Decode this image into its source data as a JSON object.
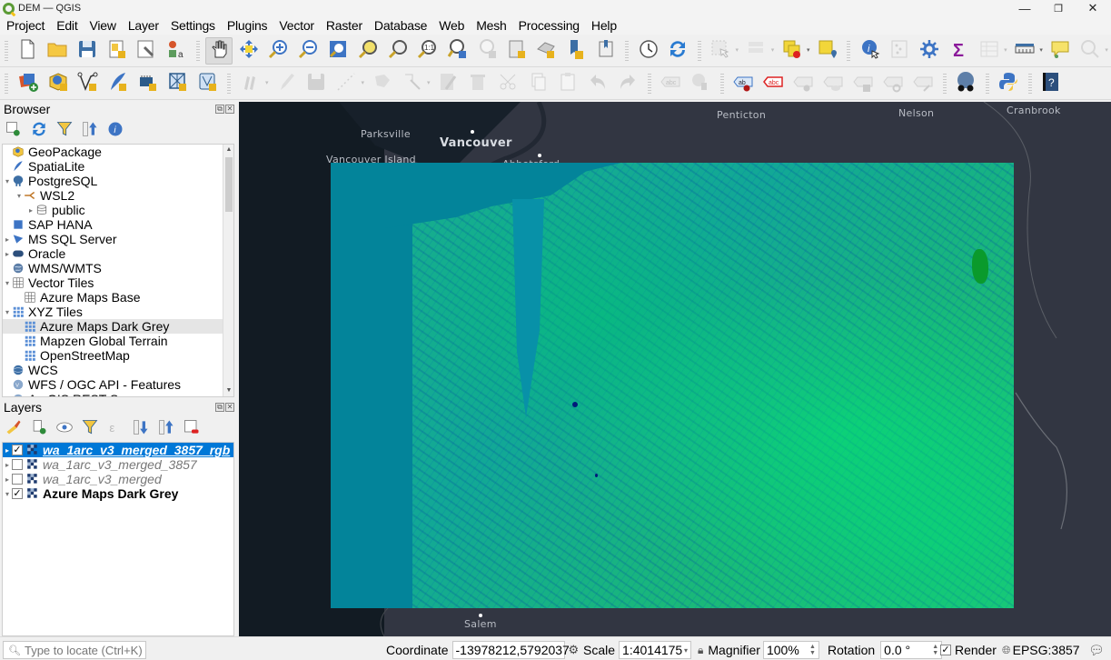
{
  "window": {
    "title": "DEM — QGIS",
    "controls": {
      "minimize": "—",
      "restore": "❐",
      "close": "✕"
    }
  },
  "menu": [
    "Project",
    "Edit",
    "View",
    "Layer",
    "Settings",
    "Plugins",
    "Vector",
    "Raster",
    "Database",
    "Web",
    "Mesh",
    "Processing",
    "Help"
  ],
  "toolbar1": [
    {
      "name": "new-project",
      "icon": "new-file-icon"
    },
    {
      "name": "open-project",
      "icon": "folder-icon"
    },
    {
      "name": "save-project",
      "icon": "save-icon"
    },
    {
      "name": "new-print-layout",
      "icon": "print-layout-icon"
    },
    {
      "name": "layout-manager",
      "icon": "layout-manager-icon"
    },
    {
      "name": "style-manager",
      "icon": "style-manager-icon"
    },
    {
      "name": "pan-map",
      "icon": "hand-icon",
      "active": true
    },
    {
      "name": "pan-to-selection",
      "icon": "pan-selection-icon"
    },
    {
      "name": "zoom-in",
      "icon": "zoom-in-icon"
    },
    {
      "name": "zoom-out",
      "icon": "zoom-out-icon"
    },
    {
      "name": "zoom-full",
      "icon": "zoom-full-icon"
    },
    {
      "name": "zoom-to-selection",
      "icon": "zoom-selection-icon"
    },
    {
      "name": "zoom-to-layer",
      "icon": "zoom-layer-icon"
    },
    {
      "name": "zoom-native",
      "icon": "zoom-native-icon"
    },
    {
      "name": "zoom-last",
      "icon": "zoom-last-icon"
    },
    {
      "name": "zoom-next",
      "icon": "zoom-next-icon",
      "disabled": true
    },
    {
      "name": "new-map-view",
      "icon": "map-view-icon"
    },
    {
      "name": "new-3d-view",
      "icon": "3d-view-icon"
    },
    {
      "name": "new-bookmark",
      "icon": "bookmark-add-icon"
    },
    {
      "name": "show-bookmarks",
      "icon": "bookmarks-icon"
    },
    {
      "name": "temporal-controller",
      "icon": "clock-icon"
    },
    {
      "name": "refresh",
      "icon": "refresh-icon"
    },
    {
      "name": "select-features",
      "icon": "select-icon",
      "disabled": true,
      "dropdown": true
    },
    {
      "name": "select-by-value",
      "icon": "select-value-icon",
      "disabled": true,
      "dropdown": true
    },
    {
      "name": "deselect",
      "icon": "deselect-icon",
      "dropdown": true
    },
    {
      "name": "select-by-location",
      "icon": "select-location-icon"
    },
    {
      "name": "identify",
      "icon": "identify-icon"
    },
    {
      "name": "field-calculator",
      "icon": "abacus-icon",
      "disabled": true
    },
    {
      "name": "processing-toolbox",
      "icon": "gear-icon"
    },
    {
      "name": "statistical-summary",
      "icon": "sigma-icon"
    },
    {
      "name": "attribute-table",
      "icon": "table-icon",
      "disabled": true,
      "dropdown": true
    },
    {
      "name": "measure",
      "icon": "ruler-icon",
      "dropdown": true
    },
    {
      "name": "map-tips",
      "icon": "speech-bubble-icon"
    },
    {
      "name": "locator",
      "icon": "search-gear-icon",
      "disabled": true,
      "dropdown": true
    }
  ],
  "toolbar2": [
    {
      "name": "data-source-manager",
      "icon": "add-layers-icon"
    },
    {
      "name": "new-geopackage-layer",
      "icon": "geopackage-add-icon"
    },
    {
      "name": "new-shapefile-layer",
      "icon": "vertex-add-icon"
    },
    {
      "name": "new-spatialite-layer",
      "icon": "feather-add-icon"
    },
    {
      "name": "new-temporary-layer",
      "icon": "chip-add-icon"
    },
    {
      "name": "new-virtual-layer",
      "icon": "grid-add-icon"
    },
    {
      "name": "new-mesh-layer",
      "icon": "mesh-add-icon"
    },
    {
      "name": "current-edits",
      "icon": "pencils-icon",
      "disabled": true,
      "dropdown": true
    },
    {
      "name": "toggle-editing",
      "icon": "pencil-icon",
      "disabled": true
    },
    {
      "name": "save-layer-edits",
      "icon": "save-edit-icon",
      "disabled": true
    },
    {
      "name": "digitize",
      "icon": "digitize-line-icon",
      "disabled": true,
      "dropdown": true
    },
    {
      "name": "add-polygon",
      "icon": "polygon-add-icon",
      "disabled": true
    },
    {
      "name": "vertex-tool",
      "icon": "vertex-tool-icon",
      "disabled": true,
      "dropdown": true
    },
    {
      "name": "modify-attributes",
      "icon": "edit-attributes-icon",
      "disabled": true
    },
    {
      "name": "delete-selected",
      "icon": "trash-icon",
      "disabled": true
    },
    {
      "name": "cut-features",
      "icon": "scissors-icon",
      "disabled": true
    },
    {
      "name": "copy-features",
      "icon": "copy-icon",
      "disabled": true
    },
    {
      "name": "paste-features",
      "icon": "paste-icon",
      "disabled": true
    },
    {
      "name": "undo",
      "icon": "undo-icon",
      "disabled": true
    },
    {
      "name": "redo",
      "icon": "redo-icon",
      "disabled": true
    },
    {
      "name": "layer-labeling",
      "icon": "label-abc-icon",
      "disabled": true
    },
    {
      "name": "layer-diagram",
      "icon": "diagram-icon",
      "disabled": true
    },
    {
      "name": "pin-labels",
      "icon": "label-pin-icon"
    },
    {
      "name": "highlight-labels",
      "icon": "label-highlight-icon"
    },
    {
      "name": "move-label",
      "icon": "label-move-pin-icon",
      "disabled": true
    },
    {
      "name": "show-hide-labels",
      "icon": "label-eye-icon",
      "disabled": true
    },
    {
      "name": "move-label-2",
      "icon": "label-move-icon",
      "disabled": true
    },
    {
      "name": "rotate-label",
      "icon": "label-rotate-icon",
      "disabled": true
    },
    {
      "name": "change-label",
      "icon": "label-edit-icon",
      "disabled": true
    },
    {
      "name": "metasearch",
      "icon": "globe-binoculars-icon"
    },
    {
      "name": "python-console",
      "icon": "python-icon"
    },
    {
      "name": "help",
      "icon": "help-book-icon"
    }
  ],
  "browser": {
    "title": "Browser",
    "tools": [
      "add-selected-layers-icon",
      "refresh-icon",
      "filter-icon",
      "collapse-all-icon",
      "info-icon"
    ],
    "items": [
      {
        "label": "GeoPackage",
        "icon": "geopackage-icon",
        "level": 0,
        "arrow": ""
      },
      {
        "label": "SpatiaLite",
        "icon": "spatialite-icon",
        "level": 0,
        "arrow": ""
      },
      {
        "label": "PostgreSQL",
        "icon": "postgresql-icon",
        "level": 0,
        "arrow": "▾"
      },
      {
        "label": "WSL2",
        "icon": "connection-icon",
        "level": 1,
        "arrow": "▾"
      },
      {
        "label": "public",
        "icon": "database-schema-icon",
        "level": 2,
        "arrow": "▸"
      },
      {
        "label": "SAP HANA",
        "icon": "sap-hana-icon",
        "level": 0,
        "arrow": ""
      },
      {
        "label": "MS SQL Server",
        "icon": "mssql-icon",
        "level": 0,
        "arrow": "▸"
      },
      {
        "label": "Oracle",
        "icon": "oracle-icon",
        "level": 0,
        "arrow": "▸"
      },
      {
        "label": "WMS/WMTS",
        "icon": "wms-icon",
        "level": 0,
        "arrow": ""
      },
      {
        "label": "Vector Tiles",
        "icon": "vector-tiles-icon",
        "level": 0,
        "arrow": "▾"
      },
      {
        "label": "Azure Maps Base",
        "icon": "vector-tiles-icon",
        "level": 1,
        "arrow": ""
      },
      {
        "label": "XYZ Tiles",
        "icon": "xyz-tiles-icon",
        "level": 0,
        "arrow": "▾"
      },
      {
        "label": "Azure Maps Dark Grey",
        "icon": "xyz-tiles-icon",
        "level": 1,
        "arrow": "",
        "highlight": true
      },
      {
        "label": "Mapzen Global Terrain",
        "icon": "xyz-tiles-icon",
        "level": 1,
        "arrow": ""
      },
      {
        "label": "OpenStreetMap",
        "icon": "xyz-tiles-icon",
        "level": 1,
        "arrow": ""
      },
      {
        "label": "WCS",
        "icon": "wcs-icon",
        "level": 0,
        "arrow": ""
      },
      {
        "label": "WFS / OGC API - Features",
        "icon": "wfs-icon",
        "level": 0,
        "arrow": ""
      },
      {
        "label": "ArcGIS REST Servers",
        "icon": "arcgis-icon",
        "level": 0,
        "arrow": ""
      }
    ]
  },
  "layers": {
    "title": "Layers",
    "tools": [
      "style-brush-icon",
      "add-group-icon",
      "visibility-eye-icon",
      "filter-legend-icon",
      "expression-filter-icon",
      "expand-all-icon",
      "collapse-all-icon",
      "remove-layer-icon"
    ],
    "items": [
      {
        "label": "wa_1arc_v3_merged_3857_rgb",
        "checked": true,
        "selected": true,
        "style": "italic-bold",
        "arrow": "▸"
      },
      {
        "label": "wa_1arc_v3_merged_3857",
        "checked": false,
        "selected": false,
        "style": "italic",
        "arrow": "▸"
      },
      {
        "label": "wa_1arc_v3_merged",
        "checked": false,
        "selected": false,
        "style": "italic",
        "arrow": "▸"
      },
      {
        "label": "Azure Maps Dark Grey",
        "checked": true,
        "selected": false,
        "style": "bold",
        "arrow": "▾"
      }
    ]
  },
  "map": {
    "labels": [
      {
        "text": "Parksville",
        "kind": "town"
      },
      {
        "text": "Vancouver",
        "kind": "city"
      },
      {
        "text": "Vancouver Island",
        "kind": "region"
      },
      {
        "text": "Abbotsford",
        "kind": "town"
      },
      {
        "text": "Penticton",
        "kind": "town"
      },
      {
        "text": "Nelson",
        "kind": "town"
      },
      {
        "text": "Cranbrook",
        "kind": "town"
      },
      {
        "text": "Salem",
        "kind": "town"
      }
    ],
    "raster_layer": "wa_1arc_v3_merged_3857_rgb",
    "basemap": "Azure Maps Dark Grey",
    "colors": {
      "basemap_land": "#323642",
      "basemap_water": "#121b23",
      "raster_water": "#03849a",
      "raster_land": "#17b08a"
    }
  },
  "status": {
    "locator_placeholder": "Type to locate (Ctrl+K)",
    "coordinate_label": "Coordinate",
    "coordinate_value": "-13978212,5792037",
    "scale_label": "Scale",
    "scale_value": "1:4014175",
    "magnifier_label": "Magnifier",
    "magnifier_value": "100%",
    "rotation_label": "Rotation",
    "rotation_value": "0.0 °",
    "render_label": "Render",
    "render_checked": true,
    "crs": "EPSG:3857"
  }
}
